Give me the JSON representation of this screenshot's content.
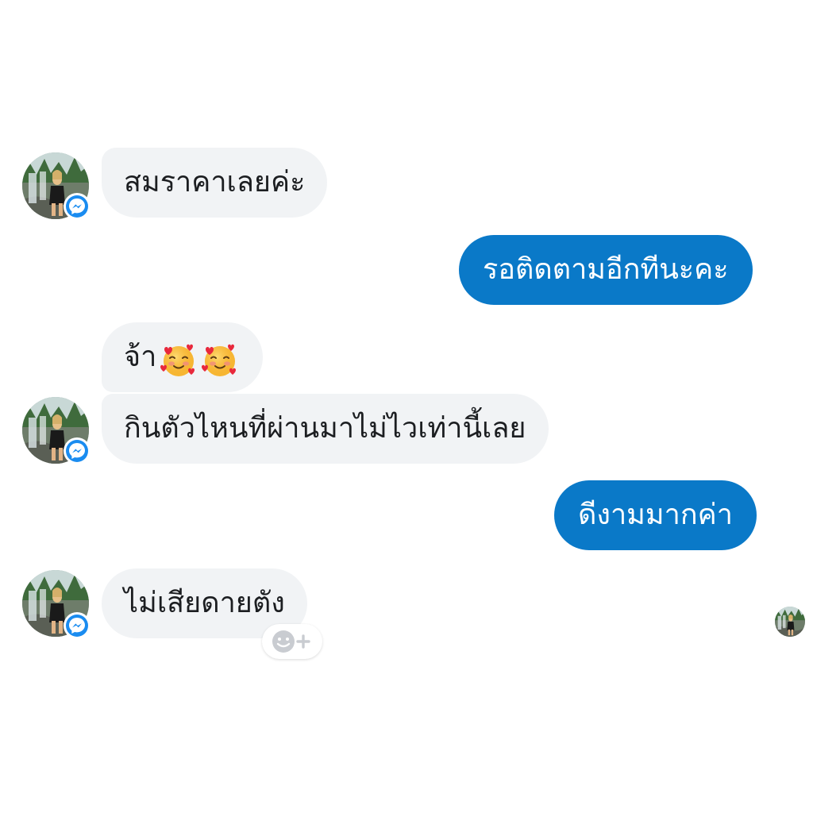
{
  "conversation": {
    "messages": [
      {
        "side": "incoming",
        "text": "สมราคาเลยค่ะ"
      },
      {
        "side": "outgoing",
        "text": "รอติดตามอีกทีนะคะ"
      },
      {
        "side": "incoming",
        "text": "จ้า",
        "emojis": [
          "smiling-face-with-hearts-emoji",
          "smiling-face-with-hearts-emoji"
        ]
      },
      {
        "side": "incoming",
        "text": "กินตัวไหนที่ผ่านมาไม่ไวเท่านี้เลย"
      },
      {
        "side": "outgoing",
        "text": "ดีงามมากค่า"
      },
      {
        "side": "incoming",
        "text": "ไม่เสียดายตัง"
      }
    ]
  },
  "colors": {
    "incoming_bubble": "#f1f3f5",
    "outgoing_bubble": "#0a79c8",
    "messenger_badge": "#1a8cf0"
  },
  "icons": {
    "messenger_badge": "messenger-icon",
    "reaction_button": "add-reaction-icon",
    "emoji": "smiling-face-with-hearts-emoji"
  }
}
